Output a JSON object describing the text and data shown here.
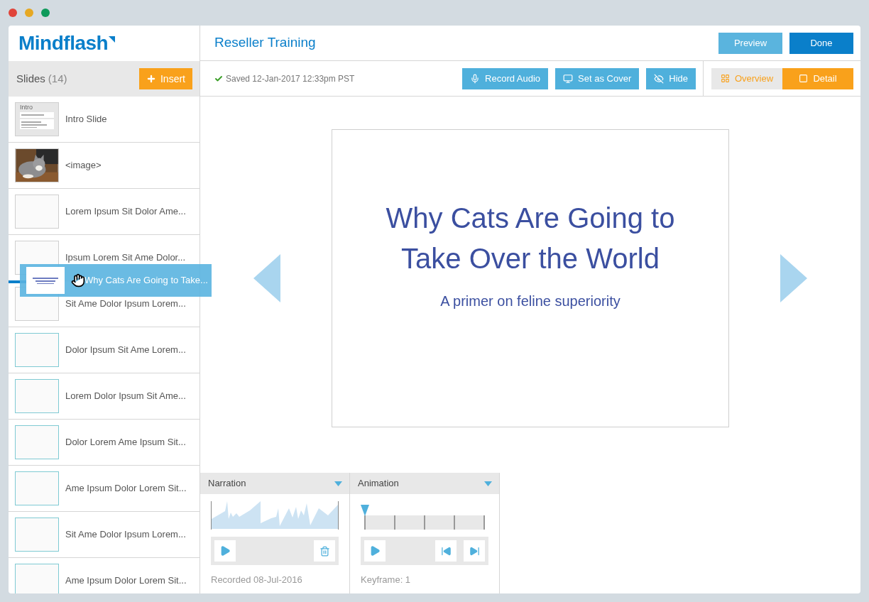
{
  "logo": {
    "text": "Mindflash"
  },
  "course_title": "Reseller Training",
  "header_buttons": [
    {
      "label": "Preview",
      "kind": "secondary"
    },
    {
      "label": "Done",
      "kind": "primary"
    }
  ],
  "slides_panel": {
    "title": "Slides",
    "count": "(14)",
    "insert_button": "Insert"
  },
  "slides": [
    {
      "title": "Intro Slide",
      "kind": "intro",
      "thumb_text": "Intro"
    },
    {
      "title": "<image>"
    },
    {
      "title": "Lorem Ipsum Sit Dolor Ame...",
      "kind": "plain"
    },
    {
      "title": "Ipsum Lorem Sit Ame Dolor...",
      "kind": "plain"
    },
    {
      "title": "Sit Ame Dolor Ipsum Lorem...",
      "kind": "plain"
    },
    {
      "title": "Dolor Ipsum Sit Ame Lorem...",
      "kind": "outlined"
    },
    {
      "title": "Lorem Dolor Ipsum Sit Ame...",
      "kind": "outlined"
    },
    {
      "title": "Dolor Lorem Ame Ipsum Sit...",
      "kind": "outlined"
    },
    {
      "title": "Ame Ipsum Dolor Lorem Sit...",
      "kind": "outlined"
    },
    {
      "title": "Sit Ame Dolor Ipsum Lorem...",
      "kind": "outlined"
    },
    {
      "title": "Ame Ipsum Dolor Lorem Sit...",
      "kind": "outlined"
    }
  ],
  "drag_ghost": {
    "title": "Why Cats Are Going to Take..."
  },
  "status": "Saved 12-Jan-2017 12:33pm PST",
  "toolbar": [
    {
      "label": "Record Audio",
      "kind": "mic"
    },
    {
      "label": "Set as Cover",
      "kind": "monitor"
    },
    {
      "label": "Hide",
      "kind": "eye"
    }
  ],
  "view_toggle": [
    {
      "label": "Overview",
      "kind": "grid",
      "selected": false
    },
    {
      "label": "Detail",
      "kind": "square",
      "selected": true
    }
  ],
  "slide": {
    "title": "Why Cats Are Going to Take Over the World",
    "subtitle": "A primer on feline superiority"
  },
  "narration": {
    "title": "Narration",
    "footer": "Recorded 08-Jul-2016"
  },
  "animation": {
    "title": "Animation",
    "footer": "Keyframe: 1",
    "level": 0
  }
}
